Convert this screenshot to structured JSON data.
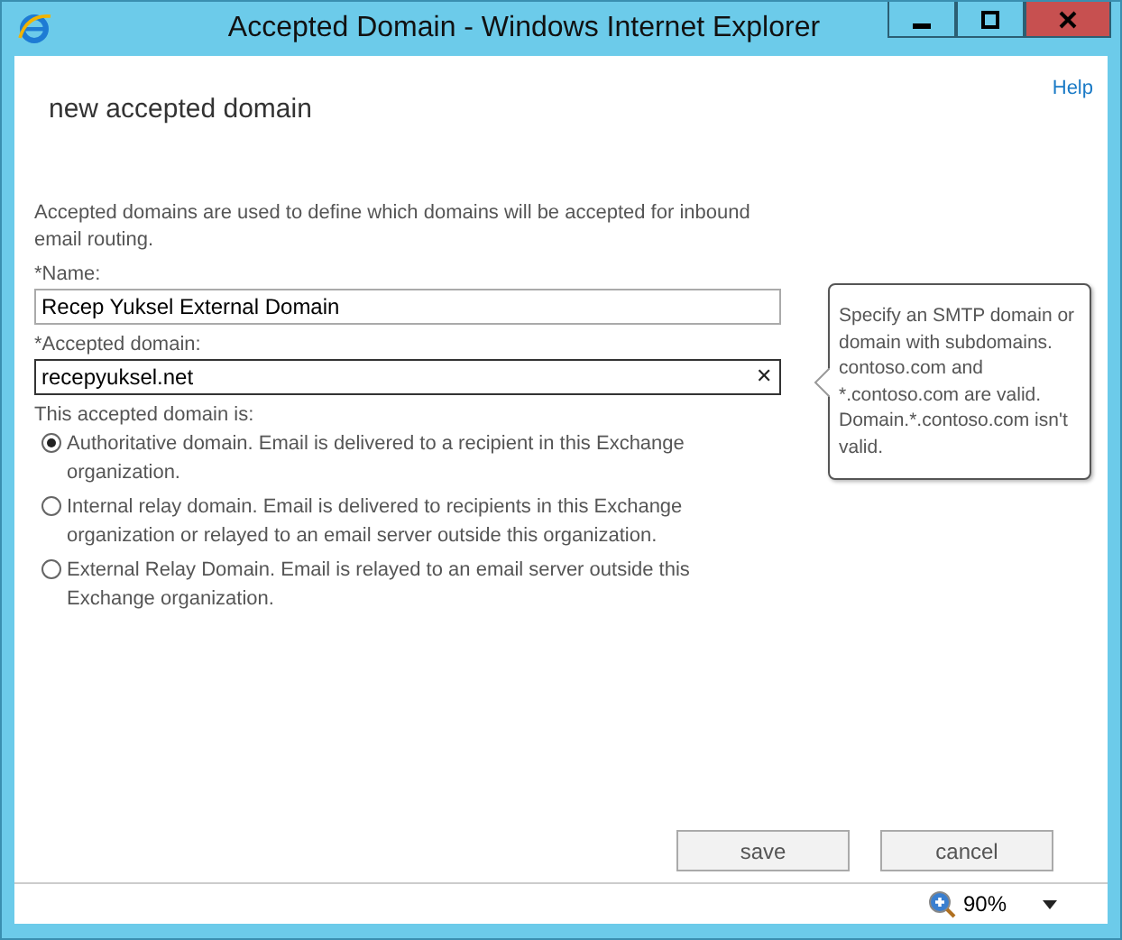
{
  "window": {
    "title": "Accepted Domain - Windows Internet Explorer"
  },
  "help_link": "Help",
  "heading": "new accepted domain",
  "description": "Accepted domains are used to define which domains will be accepted for inbound email routing.",
  "fields": [
    {
      "label": "*Name:",
      "value": "Recep Yuksel External Domain",
      "focused": false
    },
    {
      "label": "*Accepted domain:",
      "value": "recepyuksel.net",
      "focused": true,
      "clear_glyph": "✕"
    }
  ],
  "tooltip": "Specify an SMTP domain or domain with subdomains. contoso.com and *.contoso.com are valid. Domain.*.contoso.com isn't valid.",
  "radio_group": {
    "label": "This accepted domain is:",
    "options": [
      {
        "label": "Authoritative domain. Email is delivered to a recipient in this Exchange organization.",
        "selected": true
      },
      {
        "label": "Internal relay domain. Email is delivered to recipients in this Exchange organization or relayed to an email server outside this organization.",
        "selected": false
      },
      {
        "label": "External Relay Domain. Email is relayed to an email server outside this Exchange organization.",
        "selected": false
      }
    ]
  },
  "buttons": [
    "save",
    "cancel"
  ],
  "status_bar": {
    "zoom": "90%"
  }
}
